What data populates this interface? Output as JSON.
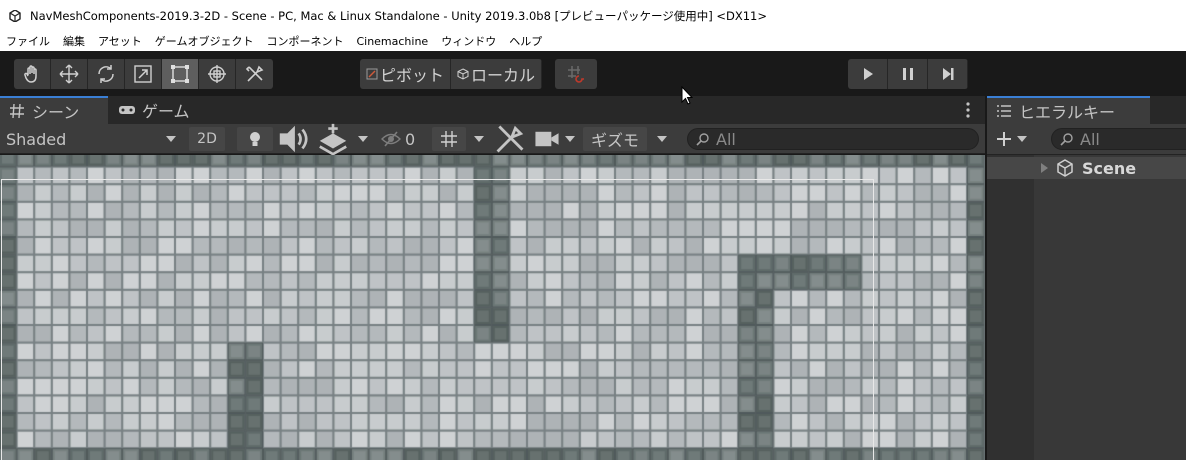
{
  "window": {
    "title": "NavMeshComponents-2019.3-2D - Scene - PC, Mac & Linux Standalone - Unity 2019.3.0b8 [プレビューパッケージ使用中] <DX11>",
    "app_icon": "unity-icon"
  },
  "menu": {
    "items": [
      "ファイル",
      "編集",
      "アセット",
      "ゲームオブジェクト",
      "コンポーネント",
      "Cinemachine",
      "ウィンドウ",
      "ヘルプ"
    ]
  },
  "toolbar": {
    "tools": [
      "hand-icon",
      "move-icon",
      "rotate-icon",
      "scale-icon",
      "rect-icon",
      "transform-icon",
      "custom-tool-icon"
    ],
    "active_tool": "rect-icon",
    "pivot_label": "ピボット",
    "local_label": "ローカル",
    "snap_icon": "grid-snap-icon",
    "playback": [
      "play-icon",
      "pause-icon",
      "step-icon"
    ]
  },
  "scene_tabs": {
    "scene_label": "シーン",
    "game_label": "ゲーム"
  },
  "scene_toolbar": {
    "shading_mode": "Shaded",
    "mode_2d": "2D",
    "hidden_count": "0",
    "gizmos_label": "ギズモ",
    "search_placeholder": "All"
  },
  "hierarchy": {
    "tab_label": "ヒエラルキー",
    "search_placeholder": "All",
    "root_scene": "Scene"
  },
  "colors": {
    "accent": "#3a7fd5",
    "editor_bg": "#3c3c3c",
    "tile_light": "#c2c6c9",
    "tile_dark": "#5e6a69"
  }
}
